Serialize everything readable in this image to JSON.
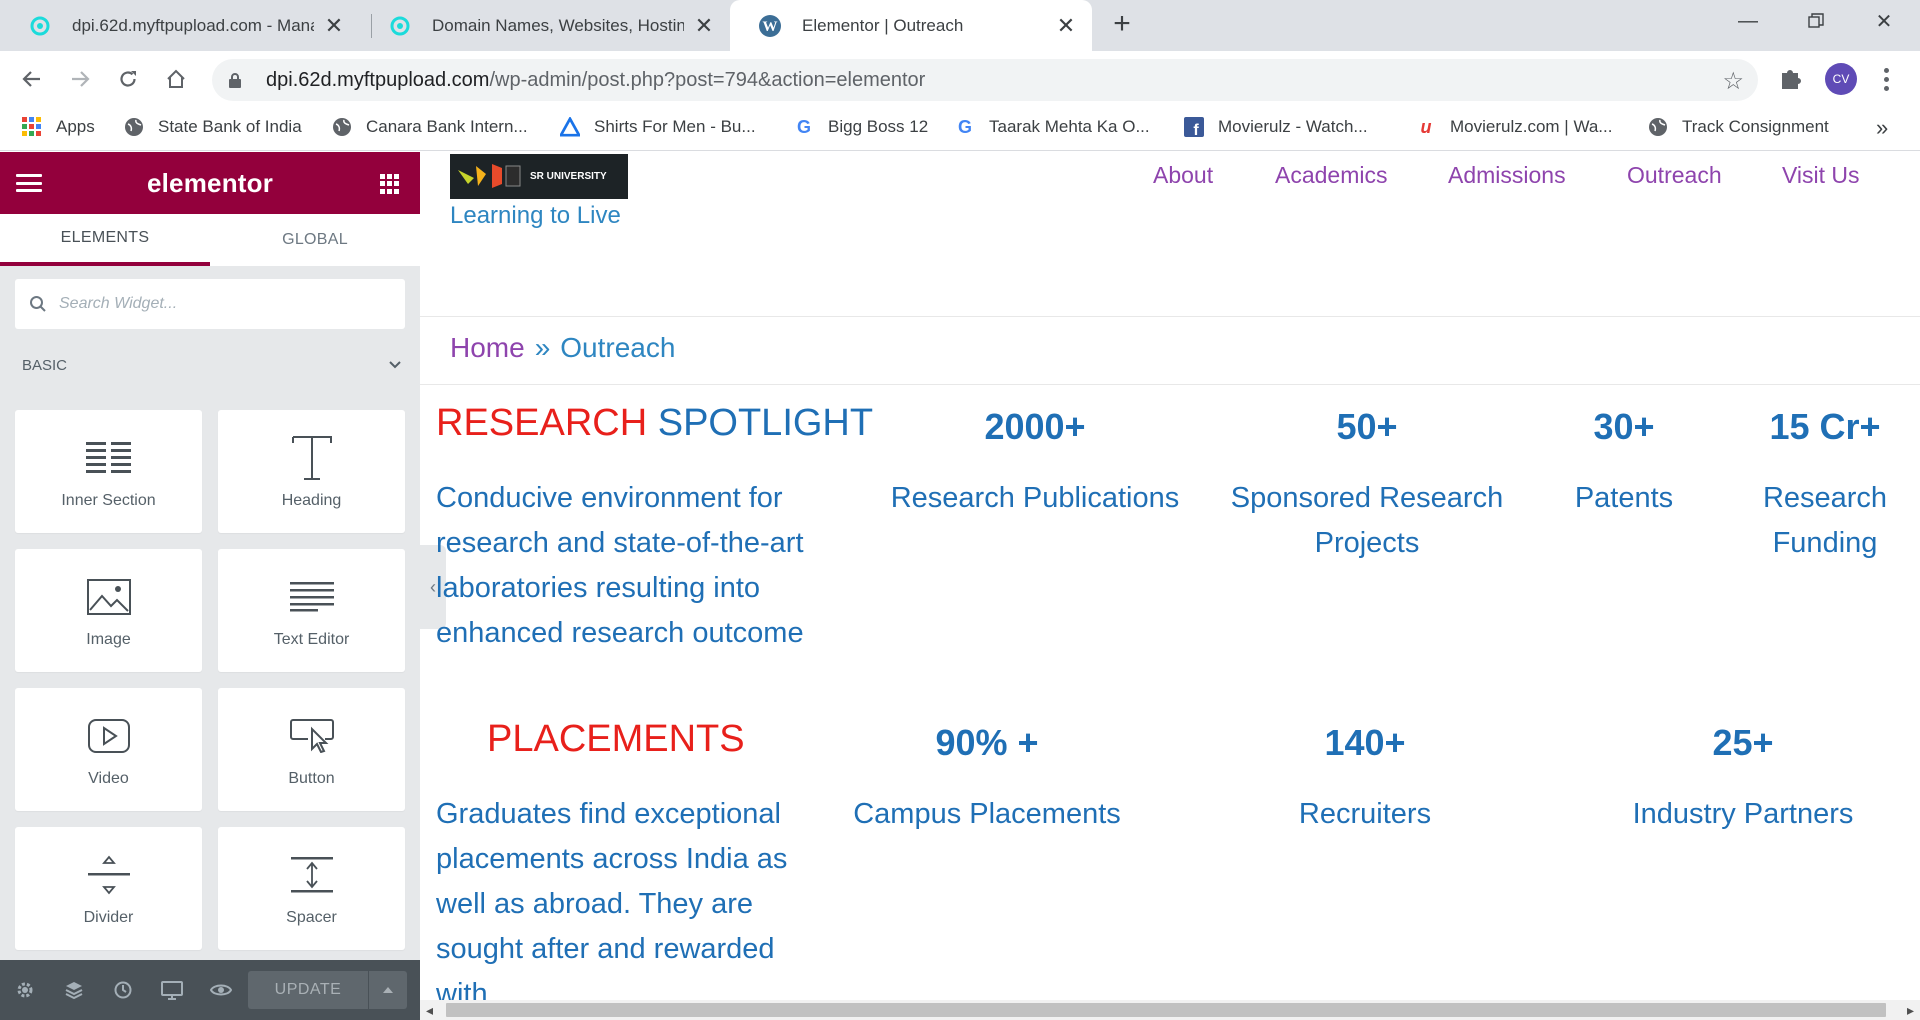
{
  "browser": {
    "tabs": [
      {
        "title": "dpi.62d.myftpupload.com - Mana",
        "icon": "godaddy-icon"
      },
      {
        "title": "Domain Names, Websites, Hostin",
        "icon": "godaddy-icon"
      },
      {
        "title": "Elementor | Outreach",
        "icon": "wordpress-icon",
        "active": true
      }
    ],
    "url_host": "dpi.62d.myftpupload.com",
    "url_path": "/wp-admin/post.php?post=794&action=elementor",
    "profile_initials": "CV",
    "bookmarks": [
      {
        "label": "Apps",
        "icon": "apps-grid-icon"
      },
      {
        "label": "State Bank of India",
        "icon": "globe-icon"
      },
      {
        "label": "Canara Bank Intern...",
        "icon": "globe-icon"
      },
      {
        "label": "Shirts For Men - Bu...",
        "icon": "triangle-logo-icon"
      },
      {
        "label": "Bigg Boss 12",
        "icon": "google-icon"
      },
      {
        "label": "Taarak Mehta Ka O...",
        "icon": "google-icon"
      },
      {
        "label": "Movierulz - Watch...",
        "icon": "facebook-icon"
      },
      {
        "label": "Movierulz.com | Wa...",
        "icon": "u-logo-icon"
      },
      {
        "label": "Track Consignment",
        "icon": "globe-icon"
      }
    ],
    "more": "»"
  },
  "panel": {
    "logo": "elementor",
    "tabs": [
      "ELEMENTS",
      "GLOBAL"
    ],
    "search_placeholder": "Search Widget...",
    "category": "BASIC",
    "widgets": [
      {
        "label": "Inner Section",
        "icon": "inner-section-icon"
      },
      {
        "label": "Heading",
        "icon": "heading-icon"
      },
      {
        "label": "Image",
        "icon": "image-icon"
      },
      {
        "label": "Text Editor",
        "icon": "text-editor-icon"
      },
      {
        "label": "Video",
        "icon": "video-icon"
      },
      {
        "label": "Button",
        "icon": "button-icon"
      },
      {
        "label": "Divider",
        "icon": "divider-icon"
      },
      {
        "label": "Spacer",
        "icon": "spacer-icon"
      }
    ],
    "update_label": "UPDATE",
    "accent": "#93003c"
  },
  "site": {
    "logo_text": "SR UNIVERSITY",
    "tagline": "Learning to Live",
    "nav": [
      "About",
      "Academics",
      "Admissions",
      "Outreach",
      "Visit Us"
    ],
    "breadcrumb": {
      "home": "Home",
      "sep": "»",
      "current": "Outreach"
    },
    "research": {
      "title_red": "RESEARCH",
      "title_blue": "SPOTLIGHT",
      "description": "Conducive environment for research and state-of-the-art laboratories resulting into enhanced research outcome",
      "stats": [
        {
          "value": "2000+",
          "label": "Research Publications"
        },
        {
          "value": "50+",
          "label": "Sponsored Research Projects"
        },
        {
          "value": "30+",
          "label": "Patents"
        },
        {
          "value": "15 Cr+",
          "label": "Research Funding"
        }
      ]
    },
    "placements": {
      "title": "PLACEMENTS",
      "description": "Graduates find exceptional placements across India as well as abroad. They are sought after and rewarded with",
      "stats": [
        {
          "value": "90% +",
          "label": "Campus Placements"
        },
        {
          "value": "140+",
          "label": "Recruiters"
        },
        {
          "value": "25+",
          "label": "Industry Partners"
        }
      ]
    },
    "colors": {
      "red": "#e8201b",
      "blue": "#1f6fb5",
      "purple": "#8e44ad"
    }
  }
}
